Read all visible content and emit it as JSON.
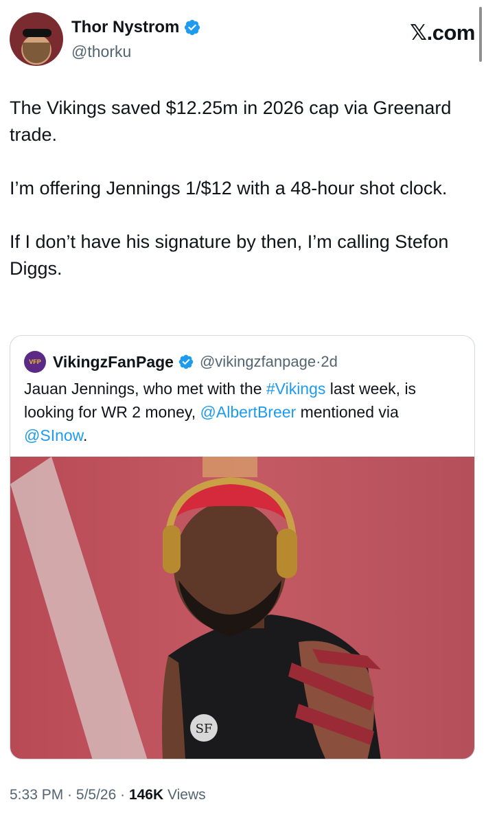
{
  "author": {
    "name": "Thor Nystrom",
    "handle": "@thorku"
  },
  "brand": "𝕏.com",
  "tweet": {
    "paragraphs": [
      "The Vikings saved $12.25m in 2026 cap via Greenard trade.",
      "I’m offering Jennings 1/$12 with a 48-hour shot clock.",
      "If I don’t have his signature by then, I’m calling Stefon Diggs."
    ]
  },
  "quote": {
    "logo_text": "VFP",
    "name": "VikingzFanPage",
    "handle": "@vikingzfanpage",
    "dot": " · ",
    "time": "2d",
    "text": {
      "t1": "Jauan Jennings, who met with the ",
      "hashtag": "#Vikings",
      "t2": " last week, is looking for WR 2 money, ",
      "mention1": "@AlbertBreer",
      "t3": " mentioned via ",
      "mention2": "@SInow",
      "t4": "."
    },
    "photo_icon": "player-photo"
  },
  "footer": {
    "time": "5:33 PM",
    "sep1": " · ",
    "date": "5/5/26",
    "sep2": " · ",
    "views_count": "146K",
    "views_label": " Views"
  },
  "colors": {
    "link": "#1d9bf0",
    "verified": "#1d9bf0",
    "secondary_text": "#536471"
  }
}
